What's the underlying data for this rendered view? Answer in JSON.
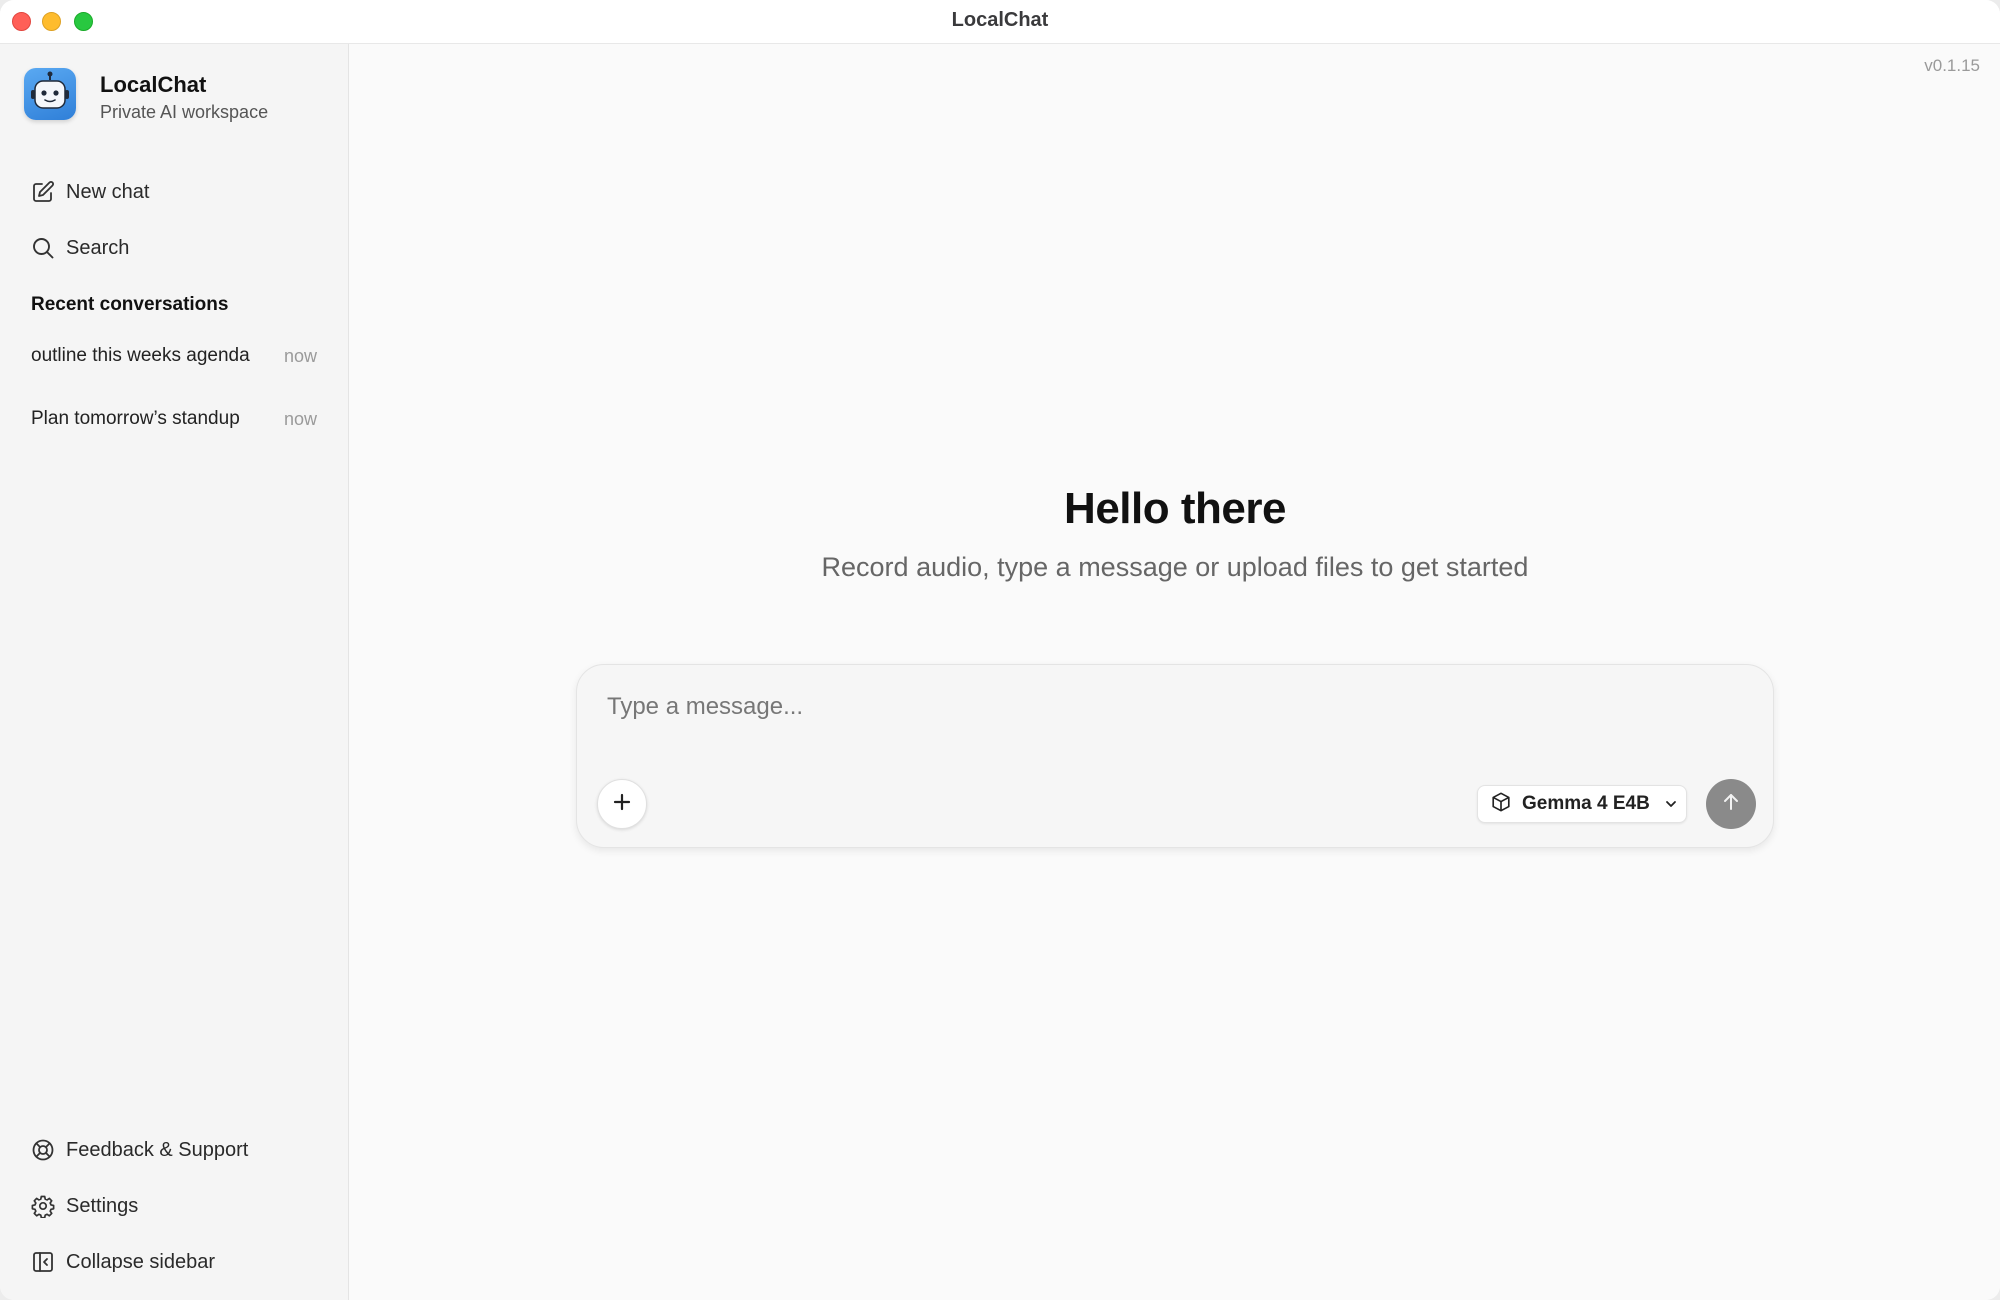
{
  "window": {
    "title": "LocalChat"
  },
  "sidebar": {
    "brand": {
      "name": "LocalChat",
      "subtitle": "Private AI workspace",
      "icon": "robot-icon"
    },
    "nav": [
      {
        "label": "New chat",
        "icon": "edit-icon"
      },
      {
        "label": "Search",
        "icon": "search-icon"
      }
    ],
    "recent_title": "Recent conversations",
    "conversations": [
      {
        "title": "outline this weeks agenda",
        "time": "now"
      },
      {
        "title": "Plan tomorrow’s standup",
        "time": "now"
      }
    ],
    "footer": [
      {
        "label": "Feedback & Support",
        "icon": "lifebuoy-icon"
      },
      {
        "label": "Settings",
        "icon": "gear-icon"
      },
      {
        "label": "Collapse sidebar",
        "icon": "sidebar-collapse-icon"
      }
    ]
  },
  "main": {
    "version": "v0.1.15",
    "heading": "Hello there",
    "subheading": "Record audio, type a message or upload files to get started",
    "composer": {
      "placeholder": "Type a message...",
      "value": "",
      "model": "Gemma 4 E4B",
      "add_icon": "plus-icon",
      "model_icon": "cube-icon",
      "send_icon": "arrow-up-icon"
    }
  },
  "colors": {
    "sidebar_bg": "#f5f5f5",
    "main_bg": "#fafafa",
    "send_button": "#8a8a8a",
    "brand_icon": "#3d8de0"
  }
}
